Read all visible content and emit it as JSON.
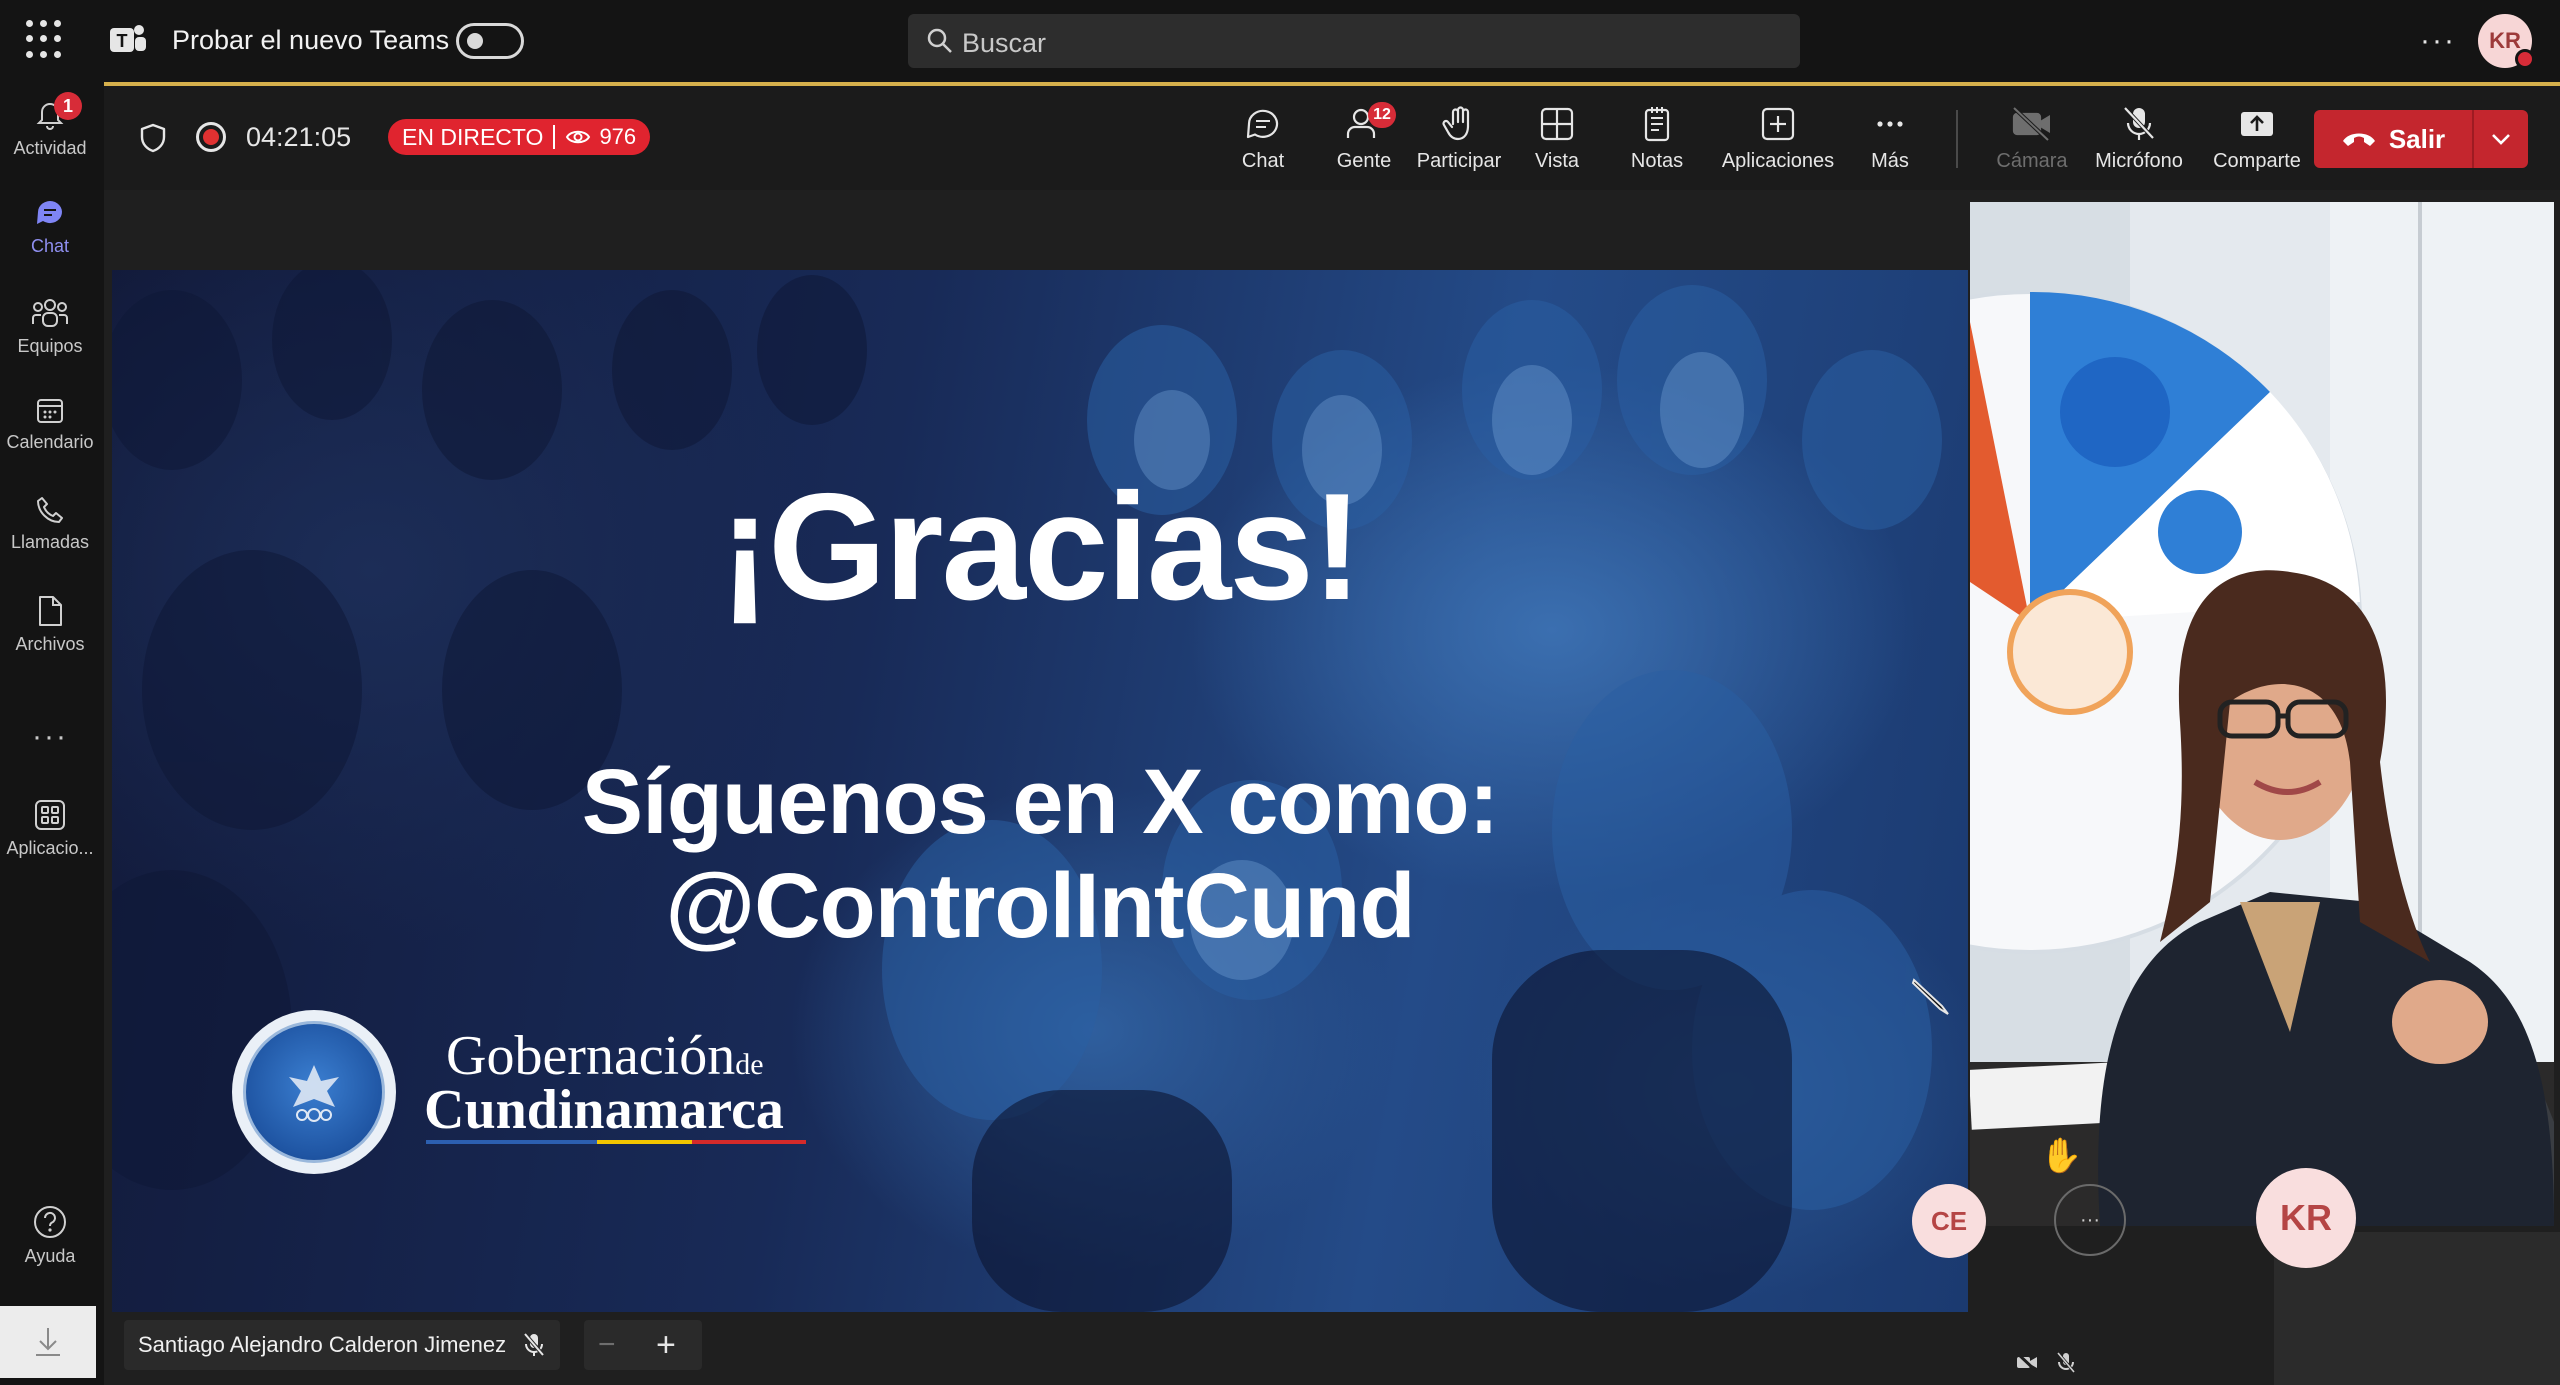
{
  "topbar": {
    "try_new_teams": "Probar el nuevo Teams",
    "search_placeholder": "Buscar",
    "more": "···",
    "user_initials": "KR"
  },
  "rail": {
    "items": [
      {
        "label": "Actividad",
        "icon": "bell-icon",
        "badge": "1"
      },
      {
        "label": "Chat",
        "icon": "chat-icon",
        "active": true
      },
      {
        "label": "Equipos",
        "icon": "teams-icon"
      },
      {
        "label": "Calendario",
        "icon": "calendar-icon"
      },
      {
        "label": "Llamadas",
        "icon": "phone-icon"
      },
      {
        "label": "Archivos",
        "icon": "file-icon"
      },
      {
        "label": "Aplicacio...",
        "icon": "apps-icon"
      },
      {
        "label": "Ayuda",
        "icon": "help-icon"
      }
    ],
    "more": "···"
  },
  "meeting": {
    "timer": "04:21:05",
    "live_label": "EN DIRECTO",
    "viewer_count": "976",
    "toolbar": [
      {
        "label": "Chat",
        "icon": "chat-icon"
      },
      {
        "label": "Gente",
        "icon": "people-icon",
        "badge": "12"
      },
      {
        "label": "Participar",
        "icon": "raise-hand-icon"
      },
      {
        "label": "Vista",
        "icon": "view-icon"
      },
      {
        "label": "Notas",
        "icon": "notes-icon"
      },
      {
        "label": "Aplicaciones",
        "icon": "apps-add-icon"
      },
      {
        "label": "Más",
        "icon": "more-icon"
      },
      {
        "label": "Cámara",
        "icon": "camera-off-icon",
        "disabled": true
      },
      {
        "label": "Micrófono",
        "icon": "mic-off-icon"
      },
      {
        "label": "Comparte",
        "icon": "share-icon"
      }
    ],
    "leave_label": "Salir",
    "colors": {
      "live": "#e0242f",
      "leave": "#c4262e",
      "accent": "#d6b04c"
    }
  },
  "slide": {
    "title": "¡Gracias!",
    "follow_line": "Síguenos en X como:",
    "handle": "@ControlIntCund",
    "org_line1": "Gobernación",
    "org_de": "de",
    "org_line2": "Cundinamarca"
  },
  "presenter": {
    "name": "Santiago Alejandro Calderon Jimenez",
    "zoom_out": "−",
    "zoom_in": "+"
  },
  "participants": {
    "ce": "CE",
    "more": "···",
    "kr": "KR",
    "hand": "✋"
  }
}
